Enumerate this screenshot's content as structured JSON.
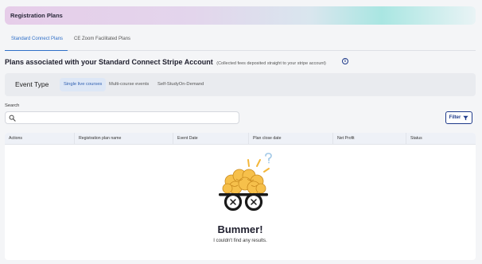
{
  "banner": {
    "title": "Registration Plans"
  },
  "tabs": [
    {
      "label": "Standard Connect Plans",
      "active": true
    },
    {
      "label": "CE Zoom Facilitated Plans",
      "active": false
    }
  ],
  "section": {
    "title": "Plans associated with your Standard Connect Stripe Account",
    "subtitle": "(Collected fees deposited straight to your stripe account)",
    "info_icon": "info-icon"
  },
  "event_type": {
    "label": "Event Type",
    "options": [
      {
        "label": "Single live courses",
        "active": true
      },
      {
        "label": "Multi-course events",
        "active": false
      },
      {
        "label": "Self-StudyOn-Demand",
        "active": false
      }
    ]
  },
  "search": {
    "label": "Search",
    "placeholder": "",
    "value": "",
    "icon": "search-icon"
  },
  "filter": {
    "label": "Filter",
    "icon": "filter-icon"
  },
  "table": {
    "columns": [
      "Actions",
      "Registration plan name",
      "Event Date",
      "Plan close date",
      "Net Profit",
      "Status"
    ],
    "rows": []
  },
  "empty_state": {
    "title": "Bummer!",
    "message": "I couldn't find any results.",
    "illustration": "confused-brain-with-glasses",
    "colors": {
      "brain": "#f4b73a",
      "glasses": "#1a1a1a",
      "question": "#9fc7e6"
    }
  },
  "colors": {
    "accent": "#2f6fc8",
    "filter_border": "#1e3a8a"
  }
}
